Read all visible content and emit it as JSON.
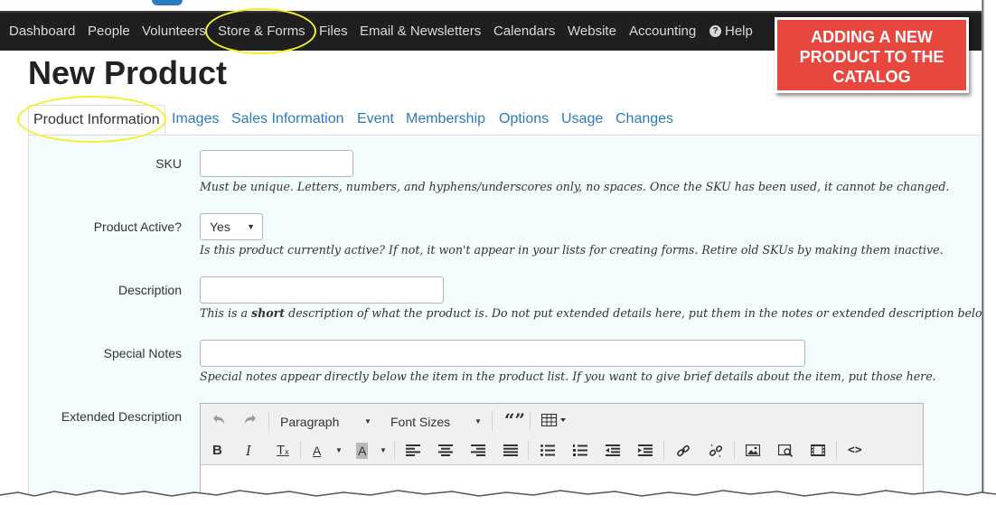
{
  "topnav": {
    "items": [
      {
        "label": "Dashboard"
      },
      {
        "label": "People"
      },
      {
        "label": "Volunteers"
      },
      {
        "label": "Store & Forms"
      },
      {
        "label": "Files"
      },
      {
        "label": "Email & Newsletters"
      },
      {
        "label": "Calendars"
      },
      {
        "label": "Website"
      },
      {
        "label": "Accounting"
      },
      {
        "label": "Help"
      }
    ]
  },
  "page": {
    "title": "New Product"
  },
  "tabs": [
    {
      "label": "Product Information",
      "active": true
    },
    {
      "label": "Images"
    },
    {
      "label": "Sales Information"
    },
    {
      "label": "Event"
    },
    {
      "label": "Membership"
    },
    {
      "label": "Options"
    },
    {
      "label": "Usage"
    },
    {
      "label": "Changes"
    }
  ],
  "form": {
    "sku": {
      "label": "SKU",
      "value": "",
      "help": "Must be unique. Letters, numbers, and hyphens/underscores only, no spaces. Once the SKU has been used, it cannot be changed."
    },
    "active": {
      "label": "Product Active?",
      "value": "Yes",
      "help": "Is this product currently active? If not, it won't appear in your lists for creating forms. Retire old SKUs by making them inactive."
    },
    "description": {
      "label": "Description",
      "value": "",
      "help_before": "This is a ",
      "help_bold": "short",
      "help_after": " description of what the product is. Do not put extended details here, put them in the notes or extended description below."
    },
    "special_notes": {
      "label": "Special Notes",
      "value": "",
      "help": "Special notes appear directly below the item in the product list. If you want to give brief details about the item, put those here."
    },
    "extended": {
      "label": "Extended Description"
    }
  },
  "editor": {
    "format_select": "Paragraph",
    "font_size_select": "Font Sizes",
    "bold": "B",
    "italic": "I",
    "clear": "T",
    "text_color": "A",
    "bg_color": "A",
    "quote": "“”",
    "code": "<>"
  },
  "callout": {
    "lines": [
      "ADDING A NEW",
      "PRODUCT TO THE",
      "CATALOG"
    ]
  },
  "colors": {
    "nav_bg": "#1f1f1f",
    "link": "#2a7bbf",
    "panel_bg": "#f2fcfd",
    "callout_bg": "#e8473e",
    "highlight": "#f4ef2a"
  }
}
